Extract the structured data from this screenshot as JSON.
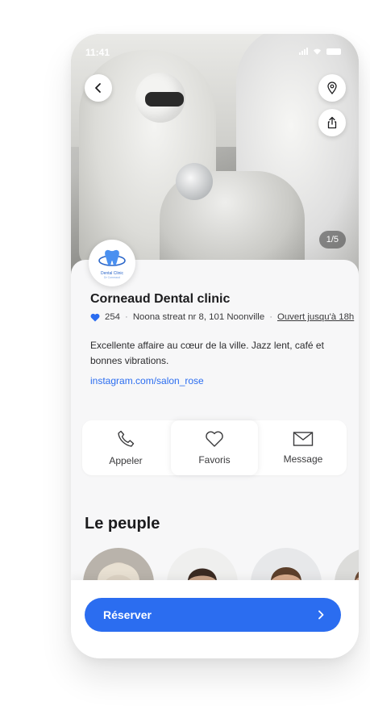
{
  "status_bar": {
    "time": "11:41"
  },
  "hero": {
    "photo_counter": "1/5"
  },
  "clinic": {
    "logo_line1": "Dental Clinic",
    "logo_line2": "Dr Corneaud",
    "name": "Corneaud Dental clinic",
    "likes": "254",
    "address": "Noona streat nr 8, 101 Noonville",
    "hours": "Ouvert jusqu'à 18h",
    "description": "Excellente affaire au cœur de la ville. Jazz lent, café et bonnes vibrations.",
    "instagram": "instagram.com/salon_rose"
  },
  "actions": {
    "call": "Appeler",
    "favorites": "Favoris",
    "message": "Message"
  },
  "people_section": {
    "title": "Le peuple"
  },
  "booking": {
    "button_label": "Réserver"
  },
  "colors": {
    "accent": "#2b6df0",
    "heart": "#2b6df0",
    "card_bg": "#f7f7f8"
  },
  "icons": [
    "back-arrow-icon",
    "map-pin-icon",
    "share-icon",
    "heart-icon",
    "phone-icon",
    "heart-outline-icon",
    "mail-icon",
    "chevron-right-icon"
  ]
}
